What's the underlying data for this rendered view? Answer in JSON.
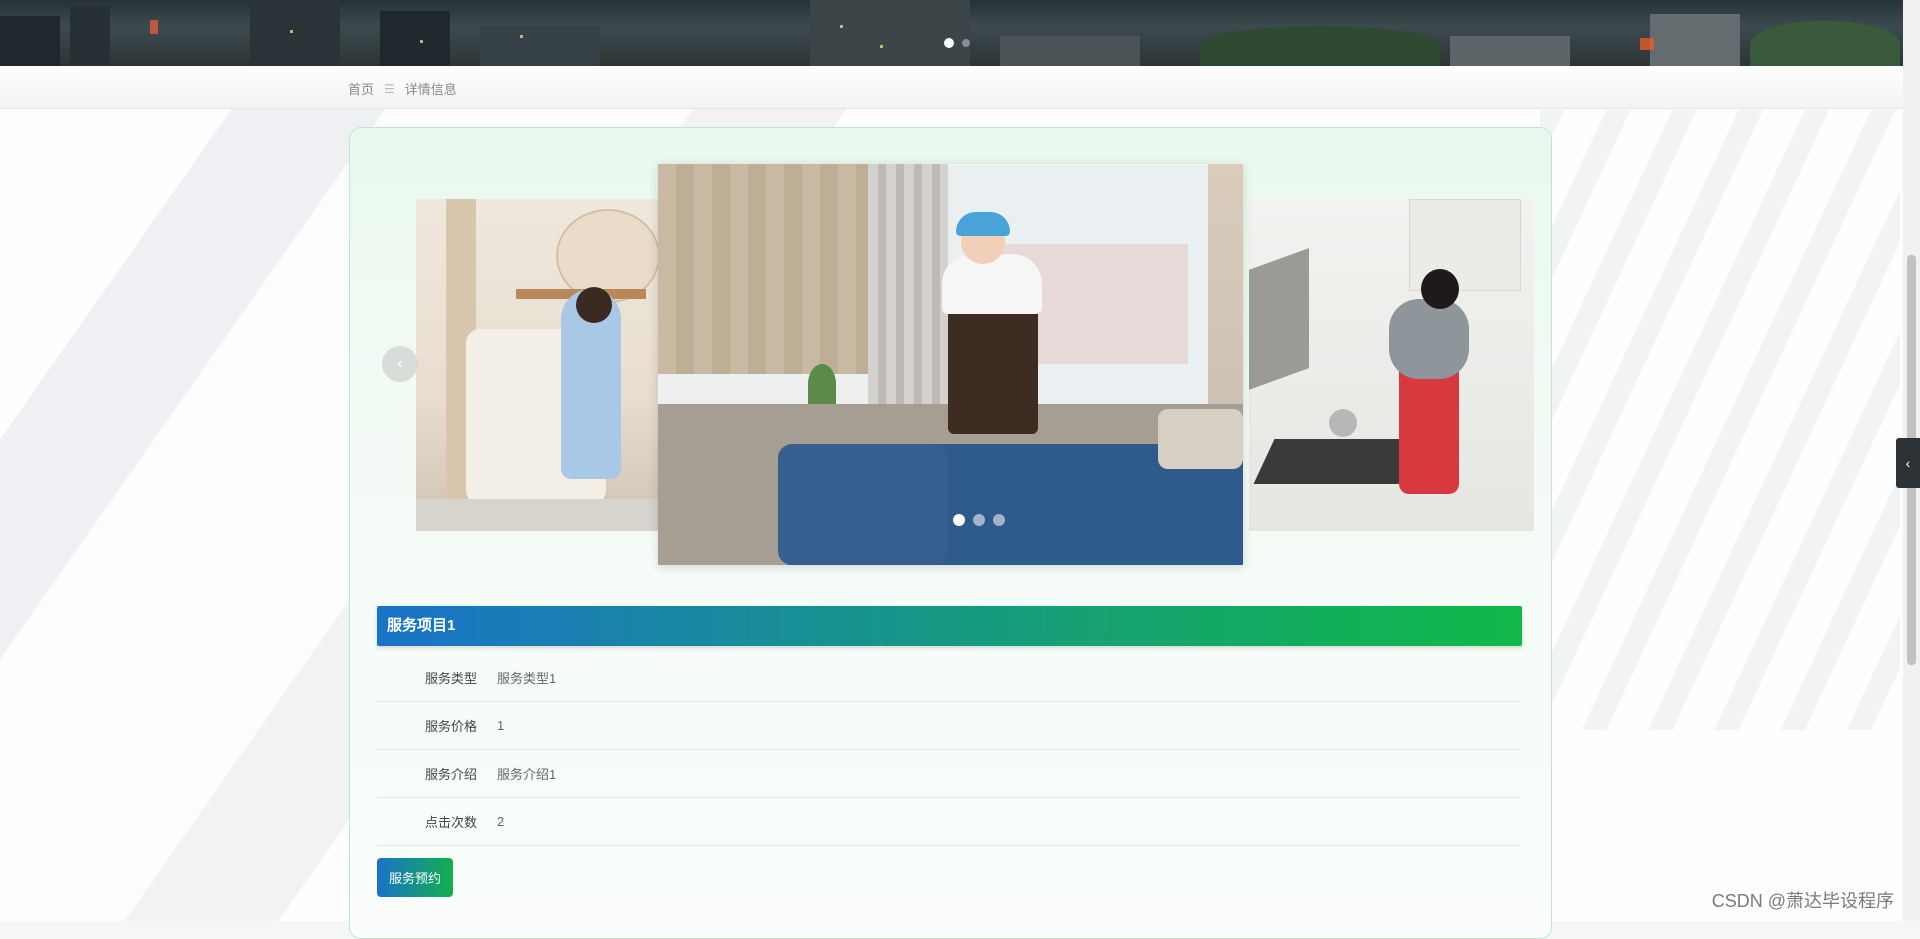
{
  "breadcrumb": {
    "home": "首页",
    "separator": "☰",
    "current": "详情信息"
  },
  "carousel": {
    "prev_icon": "chevron-left-icon",
    "prev_glyph": "‹",
    "slide_count": 3,
    "active_index": 0
  },
  "service": {
    "title": "服务项目1",
    "fields": [
      {
        "label": "服务类型",
        "value": "服务类型1"
      },
      {
        "label": "服务价格",
        "value": "1"
      },
      {
        "label": "服务介绍",
        "value": "服务介绍1"
      },
      {
        "label": "点击次数",
        "value": "2"
      }
    ],
    "book_button": "服务预约"
  },
  "side_toggle": {
    "icon": "chevron-left-icon",
    "glyph": "‹"
  },
  "watermark": "CSDN @萧达毕设程序",
  "colors": {
    "accent_blue": "#1a73c8",
    "accent_green": "#10b848",
    "card_border": "#bfe6cc"
  }
}
